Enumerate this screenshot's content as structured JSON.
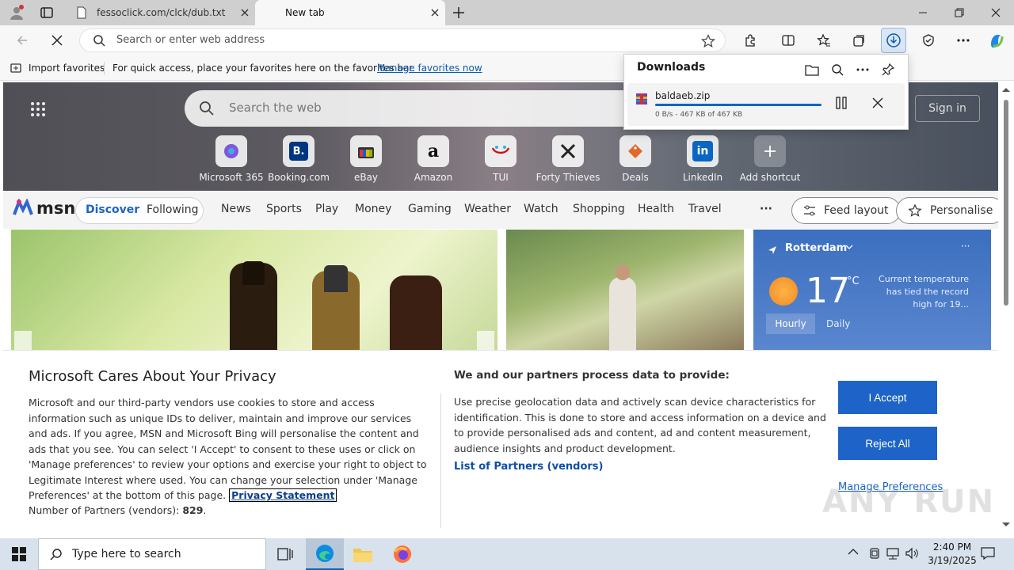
{
  "tabs": [
    {
      "title": "fessoclick.com/clck/dub.txt"
    },
    {
      "title": "New tab"
    }
  ],
  "address_bar": {
    "placeholder": "Search or enter web address"
  },
  "favorites_bar": {
    "import_label": "Import favorites",
    "hint": "For quick access, place your favorites here on the favorites bar.",
    "manage_link": "Manage favorites now"
  },
  "newtab": {
    "search_placeholder": "Search the web",
    "signin_label": "Sign in",
    "shortcuts": [
      {
        "label": "Microsoft 365",
        "icon": "m365-icon"
      },
      {
        "label": "Booking.com",
        "icon": "booking-icon"
      },
      {
        "label": "eBay",
        "icon": "ebay-icon"
      },
      {
        "label": "Amazon",
        "icon": "amazon-icon"
      },
      {
        "label": "TUI",
        "icon": "tui-icon"
      },
      {
        "label": "Forty Thieves",
        "icon": "forty-thieves-icon"
      },
      {
        "label": "Deals",
        "icon": "deals-icon"
      },
      {
        "label": "LinkedIn",
        "icon": "linkedin-icon"
      },
      {
        "label": "Add shortcut",
        "icon": "plus-icon"
      }
    ],
    "brand": "msn",
    "nav": {
      "discover": "Discover",
      "following": "Following",
      "items": [
        "News",
        "Sports",
        "Play",
        "Money",
        "Gaming",
        "Weather",
        "Watch",
        "Shopping",
        "Health",
        "Travel"
      ],
      "more": "···",
      "feed_layout": "Feed layout",
      "personalise": "Personalise"
    },
    "weather": {
      "city": "Rotterdam",
      "temp": "17",
      "unit": "°C",
      "note": "Current temperature has tied the record high for 19...",
      "tab_hourly": "Hourly",
      "tab_daily": "Daily"
    }
  },
  "downloads": {
    "title": "Downloads",
    "file": "baldaeb.zip",
    "progress": 1.0,
    "meta": "0 B/s - 467 KB of 467 KB"
  },
  "privacy": {
    "title": "Microsoft Cares About Your Privacy",
    "body": "Microsoft and our third-party vendors use cookies to store and access information such as unique IDs to deliver, maintain and improve our services and ads. If you agree, MSN and Microsoft Bing will personalise the content and ads that you see. You can select 'I Accept' to consent to these uses or click on 'Manage preferences' to review your options and exercise your right to object to Legitimate Interest where used. You can change your selection under 'Manage Preferences' at the bottom of this page.",
    "privacy_link": "Privacy Statement",
    "partners_count_label": "Number of Partners (vendors):",
    "partners_count": "829",
    "purposes_title": "We and our partners process data to provide:",
    "purposes": "Use precise geolocation data and actively scan device characteristics for identification. This is done to store and access information on a device and to provide personalised ads and content, ad and content measurement, audience insights and product development.",
    "partners_link": "List of Partners (vendors)",
    "accept": "I Accept",
    "reject": "Reject All",
    "manage": "Manage Preferences"
  },
  "watermark": "ANY RUN",
  "taskbar": {
    "search_placeholder": "Type here to search",
    "time": "2:40 PM",
    "date": "3/19/2025"
  },
  "colors": {
    "accent": "#1e63c8",
    "link": "#0b5cad",
    "taskbar": "#d8e2ec"
  }
}
